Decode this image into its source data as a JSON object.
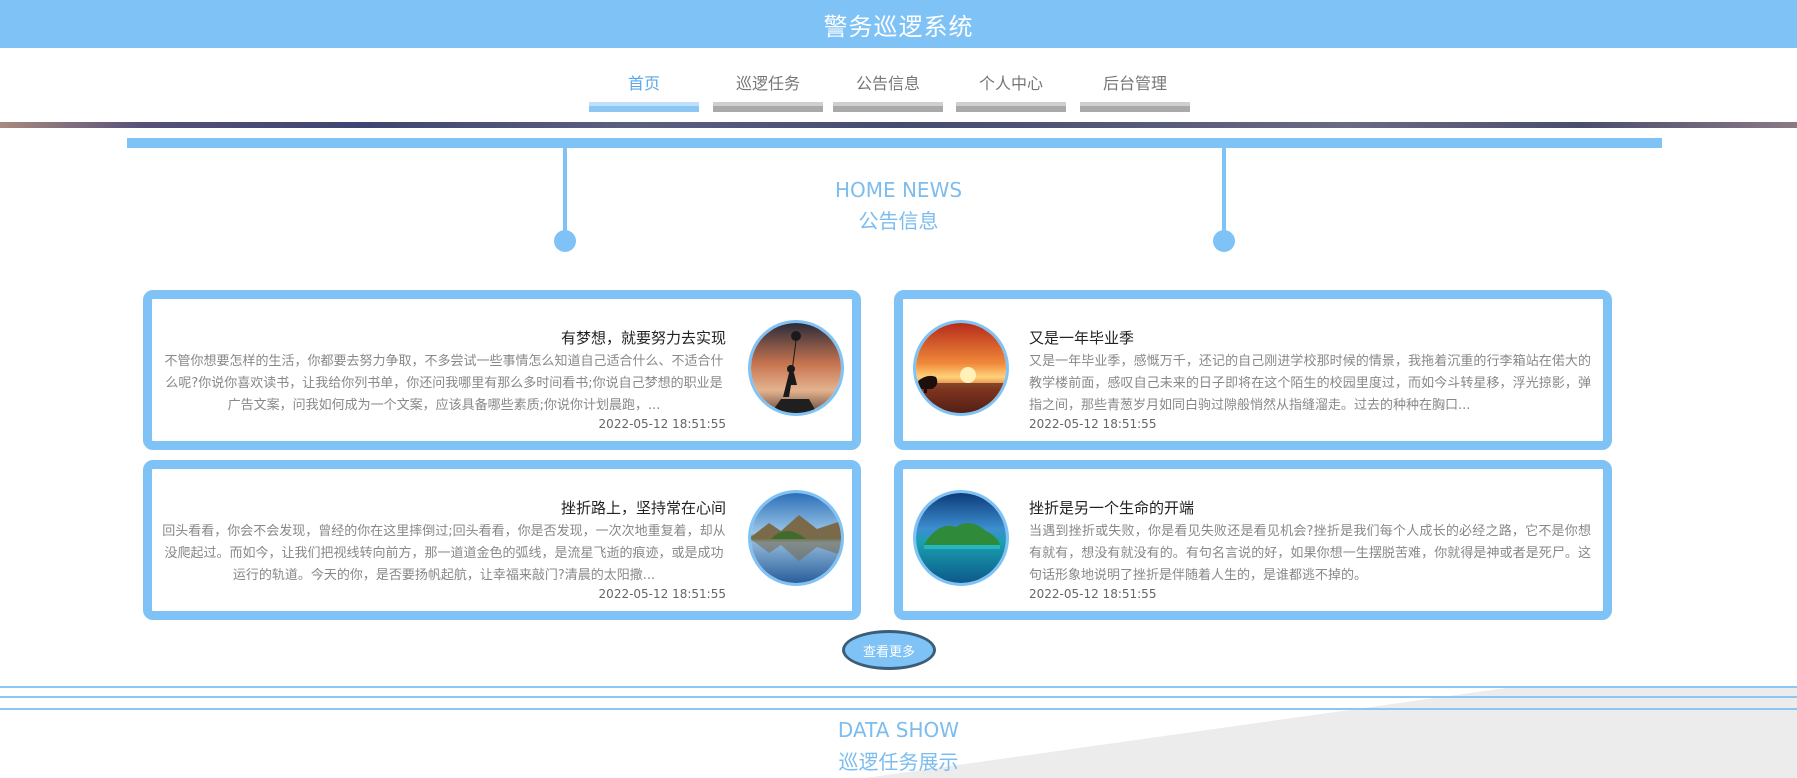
{
  "header": {
    "title": "警务巡逻系统"
  },
  "nav": {
    "items": [
      {
        "label": "首页",
        "active": true
      },
      {
        "label": "巡逻任务",
        "active": false
      },
      {
        "label": "公告信息",
        "active": false
      },
      {
        "label": "个人中心",
        "active": false
      },
      {
        "label": "后台管理",
        "active": false
      }
    ]
  },
  "news_section": {
    "title_en": "HOME NEWS",
    "title_cn": "公告信息"
  },
  "news": [
    {
      "title": "有梦想，就要努力去实现",
      "excerpt": "不管你想要怎样的生活，你都要去努力争取，不多尝试一些事情怎么知道自己适合什么、不适合什么呢?你说你喜欢读书，让我给你列书单，你还问我哪里有那么多时间看书;你说自己梦想的职业是广告文案，问我如何成为一个文案，应该具备哪些素质;你说你计划晨跑，...",
      "date": "2022-05-12 18:51:55",
      "image_icon": "girl-balloon-sunset-image"
    },
    {
      "title": "又是一年毕业季",
      "excerpt": "又是一年毕业季，感慨万千，还记的自己刚进学校那时候的情景，我拖着沉重的行李箱站在偌大的教学楼前面，感叹自己未来的日子即将在这个陌生的校园里度过，而如今斗转星移，浮光掠影，弹指之间，那些青葱岁月如同白驹过隙般悄然从指缝溜走。过去的种种在胸口...",
      "date": "2022-05-12 18:51:55",
      "image_icon": "sunset-tree-image"
    },
    {
      "title": "挫折路上，坚持常在心间",
      "excerpt": "回头看看，你会不会发现，曾经的你在这里摔倒过;回头看看，你是否发现，一次次地重复着，却从没爬起过。而如今，让我们把视线转向前方，那一道道金色的弧线，是流星飞逝的痕迹，或是成功运行的轨道。今天的你，是否要扬帆起航，让幸福来敲门?清晨的太阳撒...",
      "date": "2022-05-12 18:51:55",
      "image_icon": "lake-reflection-image"
    },
    {
      "title": "挫折是另一个生命的开端",
      "excerpt": "当遇到挫折或失败，你是看见失败还是看见机会?挫折是我们每个人成长的必经之路，它不是你想有就有，想没有就没有的。有句名言说的好，如果你想一生摆脱苦难，你就得是神或者是死尸。这句话形象地说明了挫折是伴随着人生的，是谁都逃不掉的。",
      "date": "2022-05-12 18:51:55",
      "image_icon": "tropical-island-image"
    }
  ],
  "more_button": {
    "label": "查看更多"
  },
  "data_section": {
    "title_en": "DATA SHOW",
    "title_cn": "巡逻任务展示"
  },
  "colors": {
    "primary": "#7fc2f5",
    "title_text": "#7cbcee",
    "button_border": "#3a5e7a"
  }
}
